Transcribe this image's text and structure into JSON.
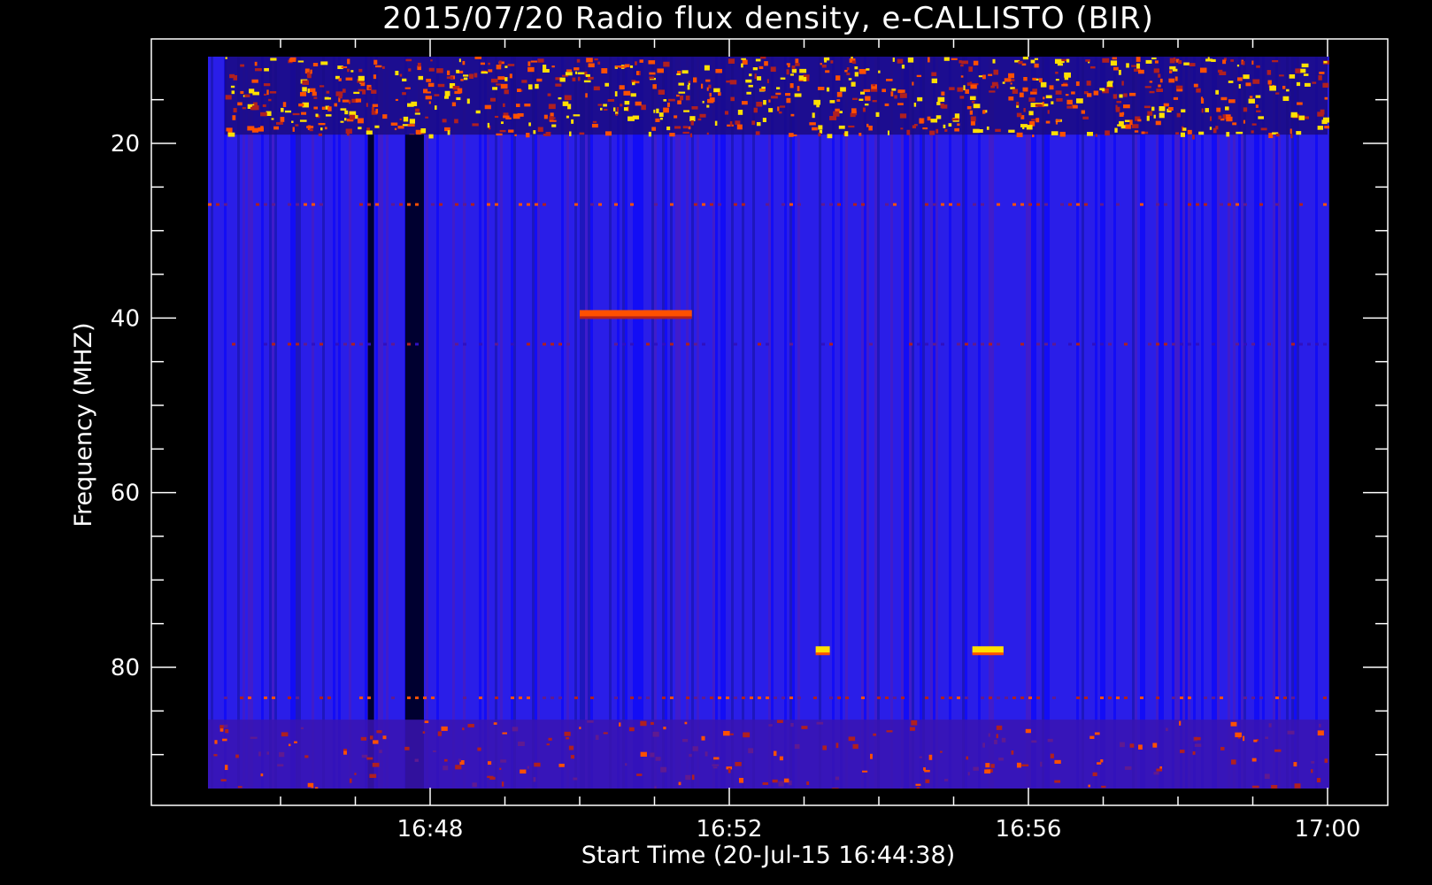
{
  "chart_data": {
    "type": "heatmap",
    "title": "2015/07/20  Radio flux density, e-CALLISTO (BIR)",
    "xlabel": "Start Time (20-Jul-15 16:44:38)",
    "ylabel": "Frequency (MHZ)",
    "x_axis": {
      "unit": "time (UT)",
      "range": [
        "16:45:15",
        "17:00:00"
      ],
      "major_ticks": [
        "16:48",
        "16:52",
        "16:56",
        "17:00"
      ],
      "minor_tick_interval_minutes": 1
    },
    "y_axis": {
      "unit": "MHz",
      "range": [
        10,
        95
      ],
      "inverted": true,
      "major_ticks": [
        20,
        40,
        60,
        80
      ],
      "minor_tick_interval": 5
    },
    "colormap": {
      "name": "blue-red-yellow",
      "stops": [
        "#000000",
        "#0000ff",
        "#b02020",
        "#ff5000",
        "#ffe000"
      ]
    },
    "features": [
      {
        "kind": "strong interference band",
        "freq_range_mhz": [
          10,
          19
        ],
        "time_range": [
          "16:45:15",
          "17:00:00"
        ],
        "intensity": "high"
      },
      {
        "kind": "data gap",
        "time_range": [
          "16:47:40",
          "16:47:55"
        ],
        "freq_range_mhz": [
          10,
          95
        ]
      },
      {
        "kind": "data gap",
        "time_range": [
          "16:47:10",
          "16:47:15"
        ],
        "freq_range_mhz": [
          10,
          95
        ]
      },
      {
        "kind": "persistent line",
        "freq_mhz": 27,
        "intensity": "medium"
      },
      {
        "kind": "persistent line",
        "freq_mhz": 43,
        "intensity": "low"
      },
      {
        "kind": "persistent line",
        "freq_mhz": 83.5,
        "intensity": "medium"
      },
      {
        "kind": "interference band",
        "freq_range_mhz": [
          86,
          95
        ],
        "intensity": "medium"
      },
      {
        "kind": "burst",
        "time": "16:53:15",
        "freq_mhz": 78,
        "intensity": "high"
      },
      {
        "kind": "burst",
        "time_range": [
          "16:55:15",
          "16:55:40"
        ],
        "freq_mhz": 78,
        "intensity": "high"
      },
      {
        "kind": "burst",
        "time_range": [
          "16:50:00",
          "16:51:30"
        ],
        "freq_mhz": 39.5,
        "intensity": "medium"
      }
    ]
  }
}
